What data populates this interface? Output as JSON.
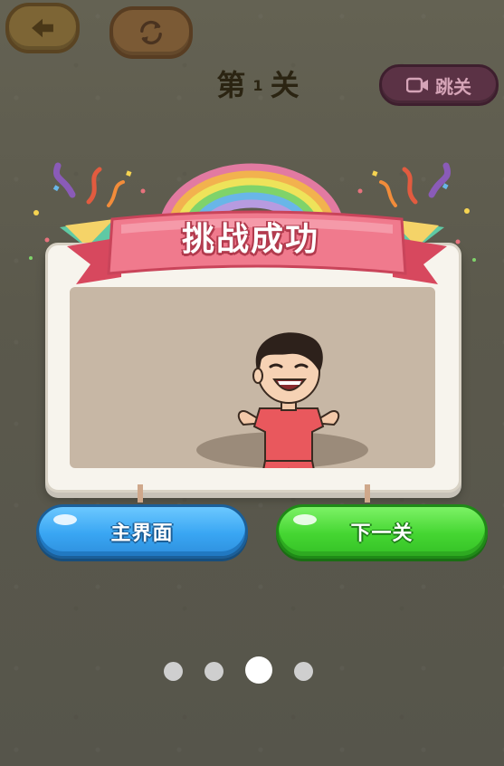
{
  "header": {
    "back_icon": "back-arrow-icon",
    "refresh_icon": "refresh-icon",
    "level_prefix": "第",
    "level_number": "1",
    "level_suffix": "关",
    "skip_label": "跳关",
    "skip_icon": "video-icon"
  },
  "result_card": {
    "title": "挑战成功"
  },
  "actions": {
    "main_menu_label": "主界面",
    "next_level_label": "下一关"
  },
  "pagination": {
    "total": 4,
    "active_index": 2
  },
  "colors": {
    "background": "#5f5d50",
    "banner": "#e86b7e",
    "main_button": "#39a6f3",
    "next_button": "#45d632",
    "skip_button": "#5b3245"
  }
}
